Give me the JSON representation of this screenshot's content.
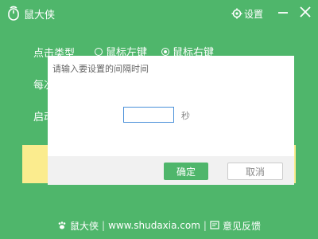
{
  "app": {
    "title": "鼠大侠"
  },
  "titlebar": {
    "settings_label": "设置"
  },
  "form": {
    "click_type_label": "点击类型",
    "options": [
      {
        "label": "鼠标左键",
        "selected": false
      },
      {
        "label": "鼠标右键",
        "selected": true
      }
    ],
    "interval_label_partial": "每次",
    "start_label_partial": "启动"
  },
  "dialog": {
    "prompt": "请输入要设置的间隔时间",
    "input_value": "",
    "unit": "秒",
    "ok_label": "确定",
    "cancel_label": "取消"
  },
  "footer": {
    "brand": "鼠大侠",
    "url": "www.shudaxia.com",
    "feedback": "意见反馈"
  },
  "colors": {
    "brand_green": "#4fb66b",
    "highlight_yellow": "#fbec8e"
  }
}
